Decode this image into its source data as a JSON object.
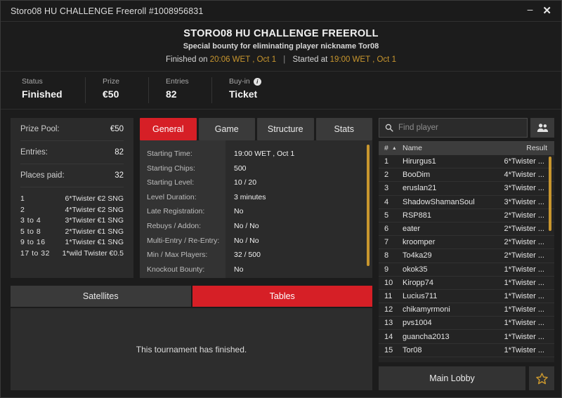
{
  "window": {
    "title": "Storo08 HU CHALLENGE Freeroll #1008956831",
    "minimize_label": "–",
    "close_label": "✕"
  },
  "header": {
    "title": "STORO08 HU CHALLENGE FREEROLL",
    "subtitle": "Special bounty for eliminating player nickname Tor08",
    "finished_prefix": "Finished on",
    "finished_time": "20:06 WET , Oct 1",
    "separator": "|",
    "started_prefix": "Started at",
    "started_time": "19:00 WET , Oct 1"
  },
  "status": {
    "items": [
      {
        "label": "Status",
        "value": "Finished",
        "info": false
      },
      {
        "label": "Prize",
        "value": "€50",
        "info": false
      },
      {
        "label": "Entries",
        "value": "82",
        "info": false
      },
      {
        "label": "Buy-in",
        "value": "Ticket",
        "info": true,
        "info_glyph": "i"
      }
    ]
  },
  "prize_panel": {
    "rows": [
      {
        "label": "Prize Pool:",
        "value": "€50"
      },
      {
        "label": "Entries:",
        "value": "82"
      },
      {
        "label": "Places paid:",
        "value": "32"
      }
    ],
    "payouts": [
      {
        "rank": "1",
        "prize": "6*Twister €2 SNG"
      },
      {
        "rank": "2",
        "prize": "4*Twister €2 SNG"
      },
      {
        "rank": "3  to  4",
        "prize": "3*Twister €1 SNG"
      },
      {
        "rank": "5  to  8",
        "prize": "2*Twister €1 SNG"
      },
      {
        "rank": "9  to  16",
        "prize": "1*Twister €1 SNG"
      },
      {
        "rank": "17  to  32",
        "prize": "1*wild Twister €0.5"
      }
    ]
  },
  "detail_tabs": [
    {
      "label": "General",
      "active": true
    },
    {
      "label": "Game",
      "active": false
    },
    {
      "label": "Structure",
      "active": false
    },
    {
      "label": "Stats",
      "active": false
    }
  ],
  "details": {
    "rows": [
      {
        "label": "Starting Time:",
        "value": "19:00 WET , Oct 1"
      },
      {
        "label": "Starting Chips:",
        "value": "500"
      },
      {
        "label": "Starting Level:",
        "value": "10 / 20"
      },
      {
        "label": "Level Duration:",
        "value": "3 minutes"
      },
      {
        "label": "Late Registration:",
        "value": "No"
      },
      {
        "label": "Rebuys / Addon:",
        "value": "No / No"
      },
      {
        "label": "Multi-Entry / Re-Entry:",
        "value": "No / No"
      },
      {
        "label": "Min / Max Players:",
        "value": "32 / 500"
      },
      {
        "label": "Knockout Bounty:",
        "value": "No"
      }
    ]
  },
  "sub_tabs": [
    {
      "label": "Satellites",
      "active": false
    },
    {
      "label": "Tables",
      "active": true
    }
  ],
  "tables_panel": {
    "message": "This tournament has finished."
  },
  "player_search": {
    "placeholder": "Find player",
    "value": "",
    "search_icon": "search-icon",
    "people_icon": "people-icon"
  },
  "player_list": {
    "columns": {
      "num": "#",
      "name": "Name",
      "result": "Result"
    },
    "sort_caret": "▲",
    "rows": [
      {
        "num": "1",
        "name": "Hirurgus1",
        "result": "6*Twister ..."
      },
      {
        "num": "2",
        "name": "BooDim",
        "result": "4*Twister ..."
      },
      {
        "num": "3",
        "name": "eruslan21",
        "result": "3*Twister ..."
      },
      {
        "num": "4",
        "name": "ShadowShamanSoul",
        "result": "3*Twister ..."
      },
      {
        "num": "5",
        "name": "RSP881",
        "result": "2*Twister ..."
      },
      {
        "num": "6",
        "name": "eater",
        "result": "2*Twister ..."
      },
      {
        "num": "7",
        "name": "kroomper",
        "result": "2*Twister ..."
      },
      {
        "num": "8",
        "name": "To4ka29",
        "result": "2*Twister ..."
      },
      {
        "num": "9",
        "name": "okok35",
        "result": "1*Twister ..."
      },
      {
        "num": "10",
        "name": "Kiropp74",
        "result": "1*Twister ..."
      },
      {
        "num": "11",
        "name": "Lucius711",
        "result": "1*Twister ..."
      },
      {
        "num": "12",
        "name": "chikamyrmoni",
        "result": "1*Twister ..."
      },
      {
        "num": "13",
        "name": "pvs1004",
        "result": "1*Twister ..."
      },
      {
        "num": "14",
        "name": "guancha2013",
        "result": "1*Twister ..."
      },
      {
        "num": "15",
        "name": "Tor08",
        "result": "1*Twister ..."
      }
    ]
  },
  "footer": {
    "main_lobby_label": "Main Lobby",
    "favorite_icon": "star-icon"
  },
  "colors": {
    "accent_red": "#d61f26",
    "accent_gold": "#c8962e",
    "panel": "#2b2b2b",
    "background": "#1c1c1c"
  }
}
